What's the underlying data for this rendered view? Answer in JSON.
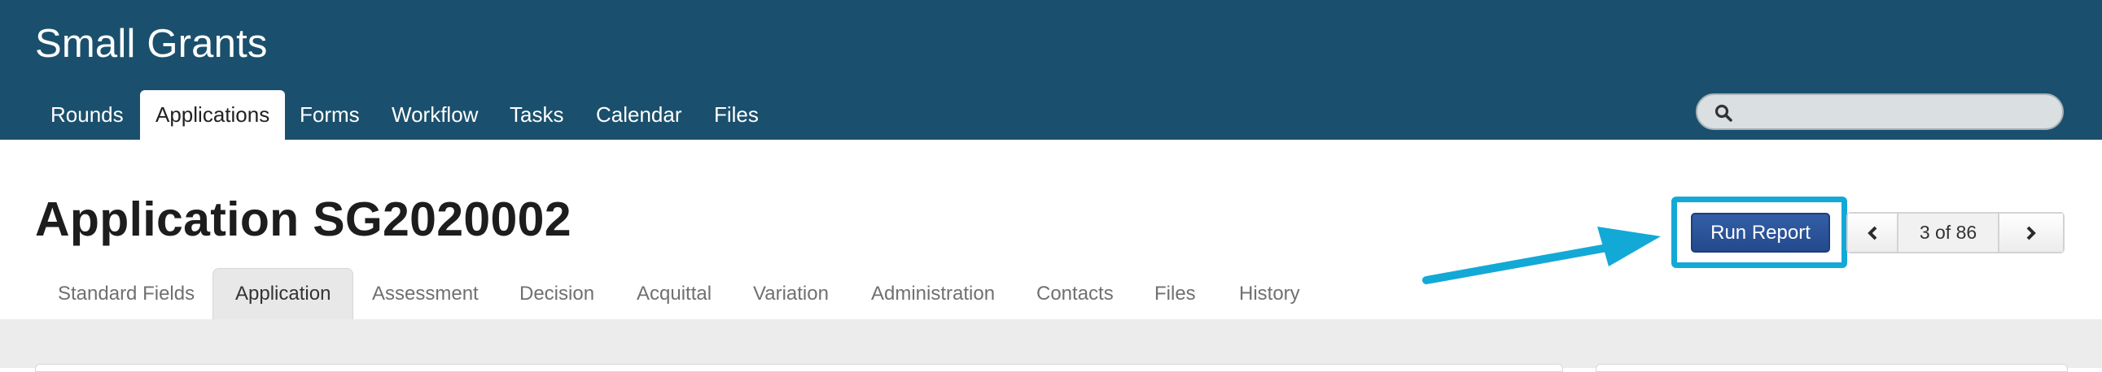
{
  "app": {
    "title": "Small Grants"
  },
  "nav": {
    "tabs": [
      {
        "label": "Rounds"
      },
      {
        "label": "Applications"
      },
      {
        "label": "Forms"
      },
      {
        "label": "Workflow"
      },
      {
        "label": "Tasks"
      },
      {
        "label": "Calendar"
      },
      {
        "label": "Files"
      }
    ],
    "active_tab": "Applications"
  },
  "search": {
    "value": "",
    "placeholder": "",
    "icon": "search-icon"
  },
  "page": {
    "title": "Application SG2020002"
  },
  "subtabs": {
    "items": [
      {
        "label": "Standard Fields"
      },
      {
        "label": "Application"
      },
      {
        "label": "Assessment"
      },
      {
        "label": "Decision"
      },
      {
        "label": "Acquittal"
      },
      {
        "label": "Variation"
      },
      {
        "label": "Administration"
      },
      {
        "label": "Contacts"
      },
      {
        "label": "Files"
      },
      {
        "label": "History"
      }
    ],
    "active_tab": "Application"
  },
  "toolbar": {
    "run_report_label": "Run Report",
    "pager": {
      "count_text": "3 of 86",
      "prev_icon": "chevron-left-icon",
      "next_icon": "chevron-right-icon"
    }
  },
  "colors": {
    "header_bg": "#1a506d",
    "highlight": "#13a9d6",
    "button_bg": "#2a5296"
  }
}
